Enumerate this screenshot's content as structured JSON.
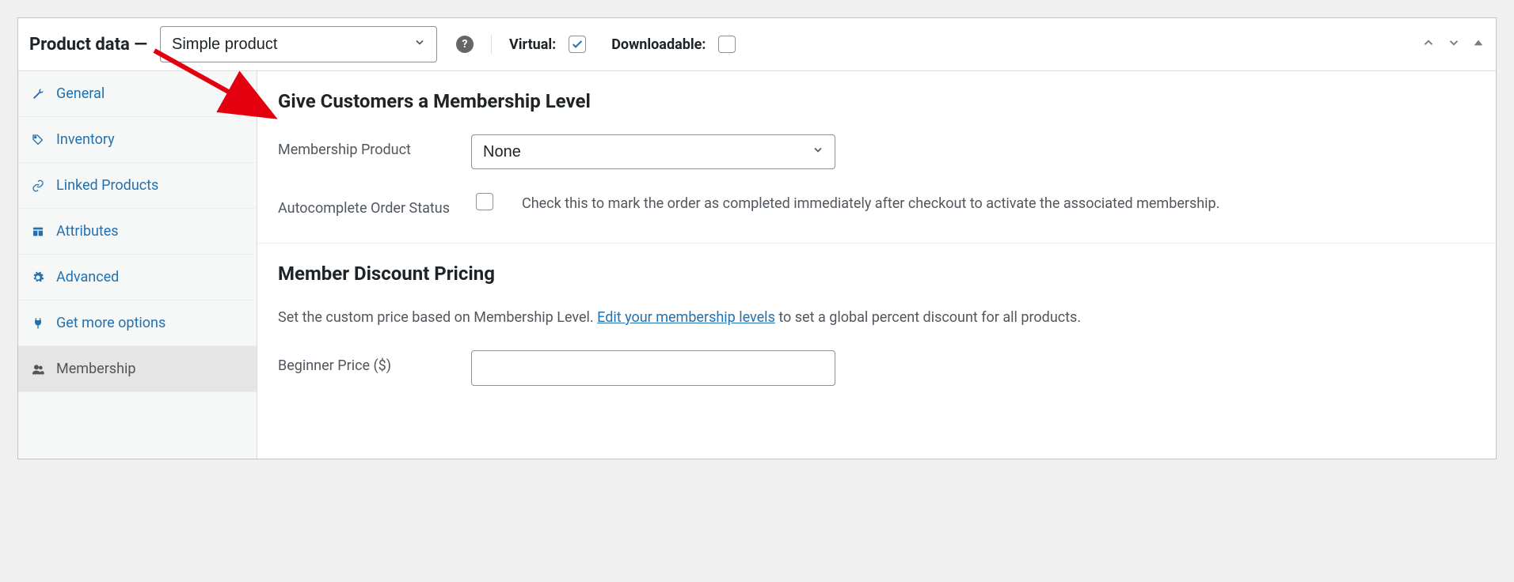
{
  "header": {
    "title": "Product data —",
    "product_type": "Simple product",
    "virtual_label": "Virtual:",
    "virtual_checked": true,
    "downloadable_label": "Downloadable:",
    "downloadable_checked": false
  },
  "sidebar": {
    "items": [
      {
        "icon": "wrench-icon",
        "label": "General"
      },
      {
        "icon": "tag-icon",
        "label": "Inventory"
      },
      {
        "icon": "link-icon",
        "label": "Linked Products"
      },
      {
        "icon": "layout-icon",
        "label": "Attributes"
      },
      {
        "icon": "gear-icon",
        "label": "Advanced"
      },
      {
        "icon": "plug-icon",
        "label": "Get more options"
      },
      {
        "icon": "users-icon",
        "label": "Membership"
      }
    ],
    "active_index": 6
  },
  "content": {
    "section1_title": "Give Customers a Membership Level",
    "membership_product_label": "Membership Product",
    "membership_product_value": "None",
    "autocomplete_label": "Autocomplete Order Status",
    "autocomplete_checked": false,
    "autocomplete_desc": "Check this to mark the order as completed immediately after checkout to activate the associated membership.",
    "section2_title": "Member Discount Pricing",
    "discount_desc_before": "Set the custom price based on Membership Level. ",
    "discount_link": "Edit your membership levels",
    "discount_desc_after": " to set a global percent discount for all products.",
    "beginner_price_label": "Beginner Price ($)",
    "beginner_price_value": ""
  }
}
